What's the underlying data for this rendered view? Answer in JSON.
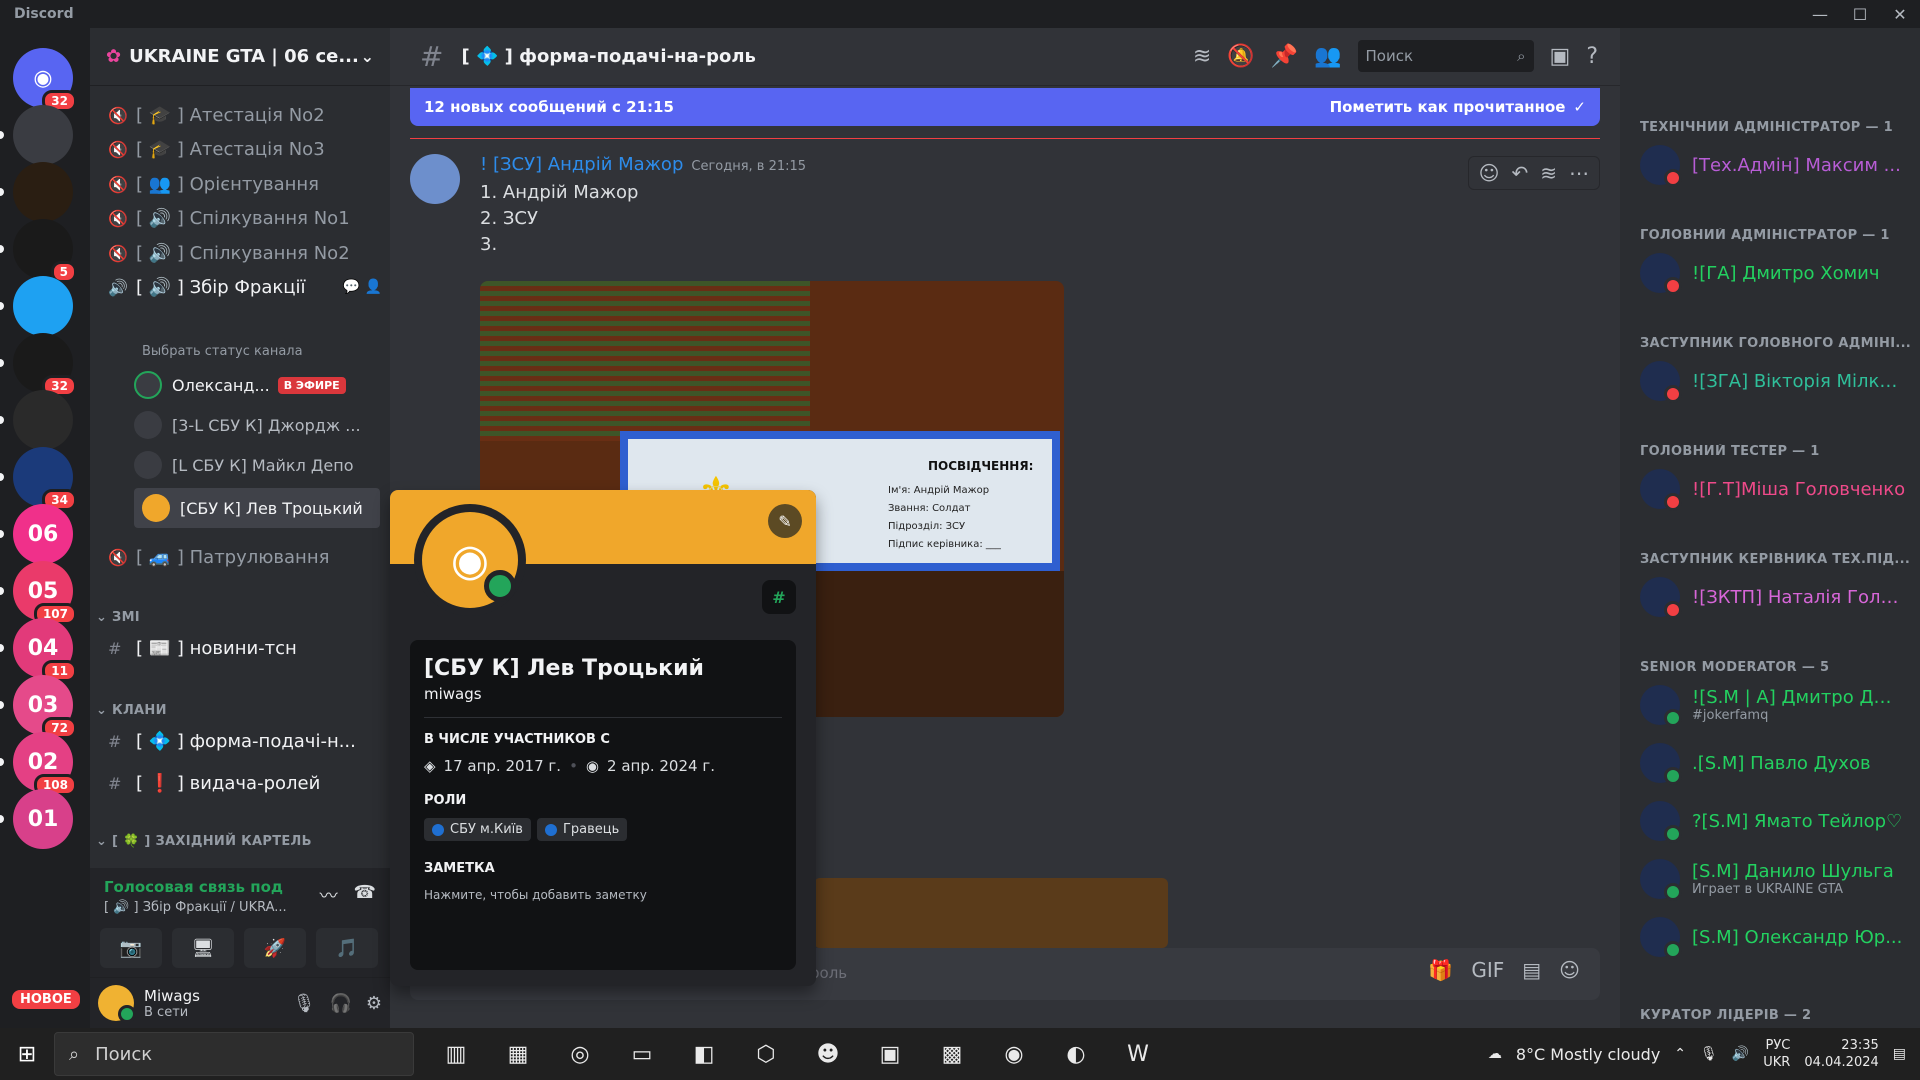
{
  "app": {
    "title": "Discord",
    "window_controls": [
      "—",
      "☐",
      "✕"
    ]
  },
  "servers": {
    "items": [
      {
        "name": "discord-home",
        "badge": "32",
        "color": "#5865f2"
      },
      {
        "name": "police-emblem",
        "badge": "",
        "color": "#3a3c42"
      },
      {
        "name": "polytsiia",
        "badge": "",
        "color": "#2a1e12"
      },
      {
        "name": "ddt",
        "badge": "5",
        "color": "#1a1a1a"
      },
      {
        "name": "blue-plane",
        "badge": "",
        "color": "#1ea1f2"
      },
      {
        "name": "cross-server",
        "badge": "32",
        "color": "#1a1a1a"
      },
      {
        "name": "hood-server",
        "badge": "",
        "color": "#2a2a2a"
      },
      {
        "name": "game-server",
        "badge": "34",
        "color": "#1b3a7a"
      },
      {
        "name": "ukraine-gta-06",
        "badge": "",
        "color": "#f0308a"
      },
      {
        "name": "ukraine-gta-05",
        "badge": "107",
        "color": "#ea3a6a"
      },
      {
        "name": "ukraine-gta-04",
        "badge": "11",
        "color": "#e23a7a"
      },
      {
        "name": "ukraine-gta-03",
        "badge": "72",
        "color": "#e54a8a"
      },
      {
        "name": "ukraine-gta-02",
        "badge": "108",
        "color": "#e44084"
      },
      {
        "name": "ukraine-gta-01",
        "badge": "",
        "color": "#d8408a"
      }
    ],
    "new_label": "НОВОЕ"
  },
  "guild": {
    "name": "UKRAINE GTA | 06 се..."
  },
  "channels": {
    "voice": [
      {
        "label": "[ 🎓 ] Атестація No2"
      },
      {
        "label": "[ 🎓 ] Атестація No3"
      },
      {
        "label": "[ 👥 ] Орієнтування"
      },
      {
        "label": "[ 🔊 ] Спілкування No1"
      },
      {
        "label": "[ 🔊 ] Спілкування No2"
      },
      {
        "label": "[ 🔊 ] Збір Фракції"
      }
    ],
    "status_hint": "Выбрать статус канала",
    "voice_users": [
      {
        "name": "Олександ...",
        "live": "В ЭФИРЕ"
      },
      {
        "name": "[3-L СБУ К] Джордж ..."
      },
      {
        "name": "[L СБУ К] Майкл Депо"
      },
      {
        "name": "[СБУ К] Лев Троцький"
      }
    ],
    "patrol": "[ 🚙 ] Патрулювання",
    "cat_zmi": "ЗМІ",
    "news": "[ 📰 ] новини-тсн",
    "cat_klany": "КЛАНИ",
    "form": "[ 💠 ] форма-подачі-н...",
    "roles": "[ ❗ ] видача-ролей",
    "cat_cartel": "[ 🍀 ] ЗАХІДНИЙ КАРТЕЛЬ"
  },
  "voicebar": {
    "status": "Голосовая связь под",
    "channel": "[ 🔊 ] Збір Фракції / UKRA..."
  },
  "user": {
    "name": "Miwags",
    "status": "В сети"
  },
  "channel_header": {
    "name": "[ 💠 ] форма-подачі-на-роль",
    "search_placeholder": "Поиск"
  },
  "banner": {
    "text": "12 новых сообщений с 21:15",
    "mark": "Пометить как прочитанное"
  },
  "message": {
    "author": "! [ЗСУ] Андрій Мажор",
    "time": "Сегодня, в 21:15",
    "lines": [
      "1. Андрій Мажор",
      "2. ЗСУ",
      "3."
    ]
  },
  "screenshot_doc": {
    "title": "ПОСВІДЧЕННЯ:",
    "rows": [
      "Ім'я: Андрій Мажор",
      "Звання: Солдат",
      "Підрозділ: ЗСУ",
      "Підпис керівника: ___"
    ]
  },
  "composer": {
    "placeholder": "роль",
    "icons": [
      "gift-icon",
      "gif-icon",
      "sticker-icon",
      "emoji-icon"
    ]
  },
  "popout": {
    "name": "[СБУ К] Лев Троцький",
    "username": "miwags",
    "member_since_label": "В ЧИСЛЕ УЧАСТНИКОВ С",
    "discord_date": "17 апр. 2017 г.",
    "server_date": "2 апр. 2024 г.",
    "roles_label": "РОЛИ",
    "roles": [
      "СБУ м.Київ",
      "Гравець"
    ],
    "note_label": "ЗАМЕТКА",
    "note_hint": "Нажмите, чтобы добавить заметку",
    "accent": "#f0a72b"
  },
  "members": {
    "groups": [
      {
        "title": "ТЕХНІЧНИЙ АДМІНІСТРАТОР — 1",
        "members": [
          {
            "name": "[Тех.Адмін] Максим ...",
            "color": "#b85dd6"
          }
        ]
      },
      {
        "title": "ГОЛОВНИЙ АДМІНІСТРАТОР — 1",
        "members": [
          {
            "name": "![ГА] Дмитро Хомич",
            "color": "#23d160"
          }
        ]
      },
      {
        "title": "ЗАСТУПНИК ГОЛОВНОГО АДМІНІ...",
        "members": [
          {
            "name": "![ЗГА] Вікторія Мілко...",
            "color": "#2fbf9a"
          }
        ]
      },
      {
        "title": "ГОЛОВНИЙ ТЕСТЕР — 1",
        "members": [
          {
            "name": "![Г.Т]Міша Головченко",
            "color": "#ef4a8a"
          }
        ]
      },
      {
        "title": "ЗАСТУПНИК КЕРІВНИКА ТЕХ.ПІД...",
        "members": [
          {
            "name": "![ЗКТП] Наталія Голо...",
            "color": "#d766d8"
          }
        ]
      },
      {
        "title": "SENIOR MODERATOR — 5",
        "members": [
          {
            "name": "![S.M | A] Дмитро Дж...",
            "sub": "#jokerfamq",
            "color": "#23d160"
          },
          {
            "name": ".[S.M] Павло Духов",
            "color": "#23d160"
          },
          {
            "name": "?[S.M] Ямато Тейлор♡",
            "color": "#23d160"
          },
          {
            "name": "[S.M] Данило Шульга",
            "sub": "Играет в UKRAINE GTA",
            "color": "#23d160"
          },
          {
            "name": "[S.M] Олександр Юр...",
            "color": "#23d160"
          }
        ]
      },
      {
        "title": "КУРАТОР ЛІДЕРІВ — 2",
        "members": []
      }
    ]
  },
  "taskbar": {
    "search": "Поиск",
    "weather": "8°C Mostly cloudy",
    "lang1": "РУС",
    "lang2": "UKR",
    "time": "23:35",
    "date": "04.04.2024"
  }
}
